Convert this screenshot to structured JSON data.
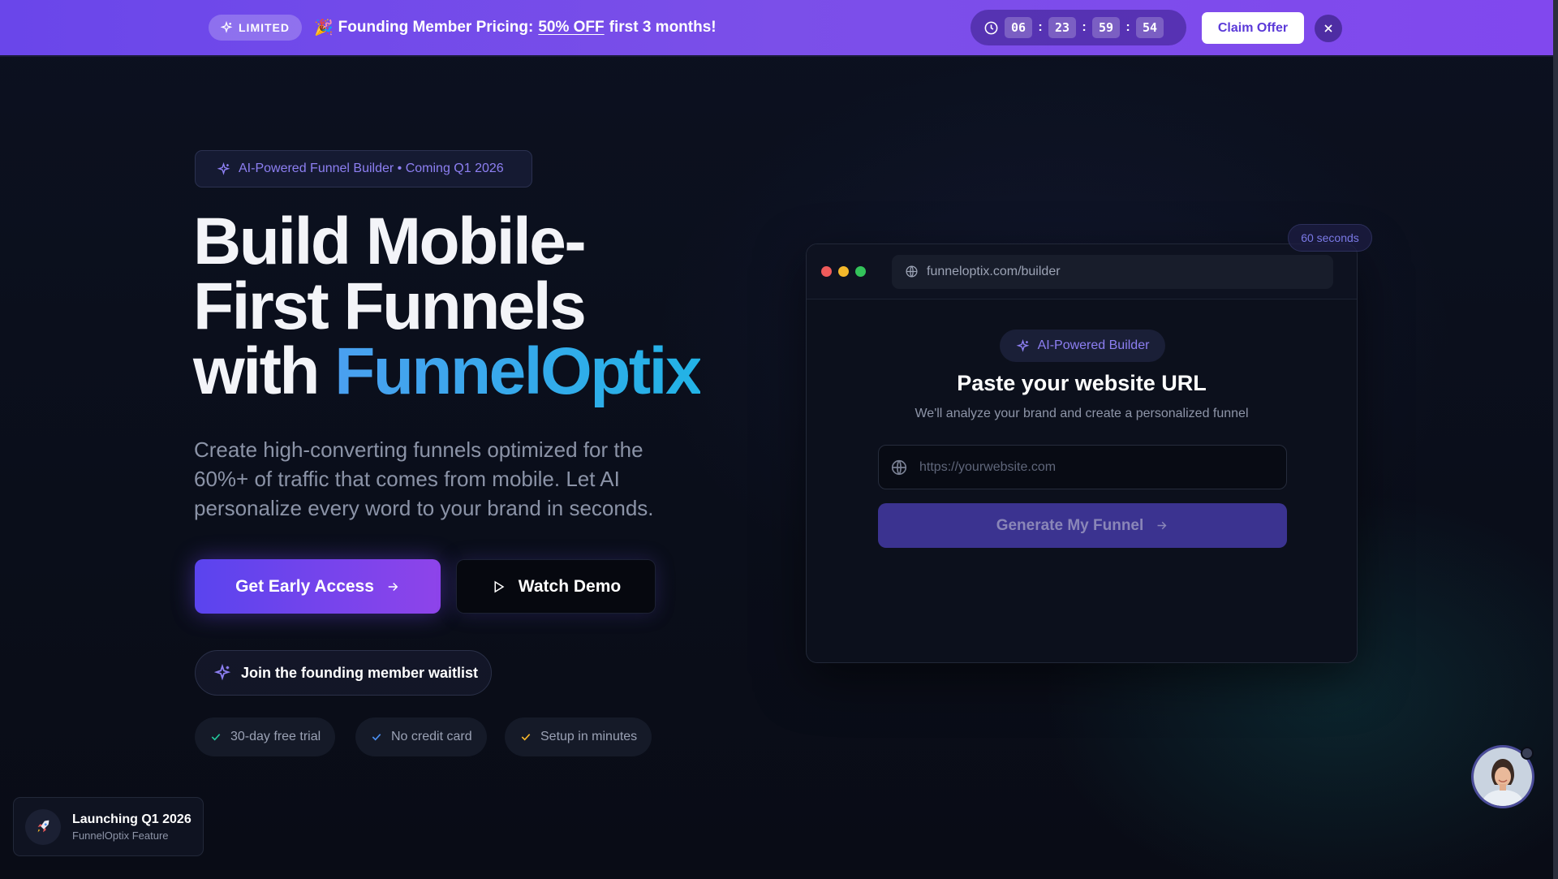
{
  "banner": {
    "badge": "LIMITED",
    "emoji": "🎉",
    "text_prefix": "Founding Member Pricing:",
    "text_off": "50% OFF",
    "text_suffix": "first 3 months!",
    "countdown": [
      "06",
      "23",
      "59",
      "54"
    ],
    "claim_label": "Claim Offer"
  },
  "hero": {
    "pill": "AI-Powered Funnel Builder • Coming Q1 2026",
    "headline_line1": "Build Mobile-",
    "headline_line2": "First Funnels",
    "headline_line3_prefix": "with ",
    "headline_brand": "FunnelOptix",
    "subtext": "Create high-converting funnels optimized for the 60%+ of traffic that comes from mobile. Let AI personalize every word to your brand in seconds.",
    "primary_cta": "Get Early Access",
    "secondary_cta": "Watch Demo",
    "waitlist": "Join the founding member waitlist",
    "features": [
      {
        "label": "30-day free trial",
        "color": "#22c59a"
      },
      {
        "label": "No credit card",
        "color": "#4a8ef0"
      },
      {
        "label": "Setup in minutes",
        "color": "#f5b52a"
      }
    ]
  },
  "builder": {
    "timer_tag": "60 seconds",
    "url_bar": "funneloptix.com/builder",
    "pill": "AI-Powered Builder",
    "title": "Paste your website URL",
    "subtitle": "We'll analyze your brand and create a personalized funnel",
    "input_placeholder": "https://yourwebsite.com",
    "generate_label": "Generate My Funnel"
  },
  "toast": {
    "title": "Launching Q1 2026",
    "subtitle": "FunnelOptix Feature"
  },
  "colors": {
    "accent": "#6a46ea",
    "brand_gradient_start": "#4aa0f0",
    "brand_gradient_end": "#22b3e6"
  }
}
